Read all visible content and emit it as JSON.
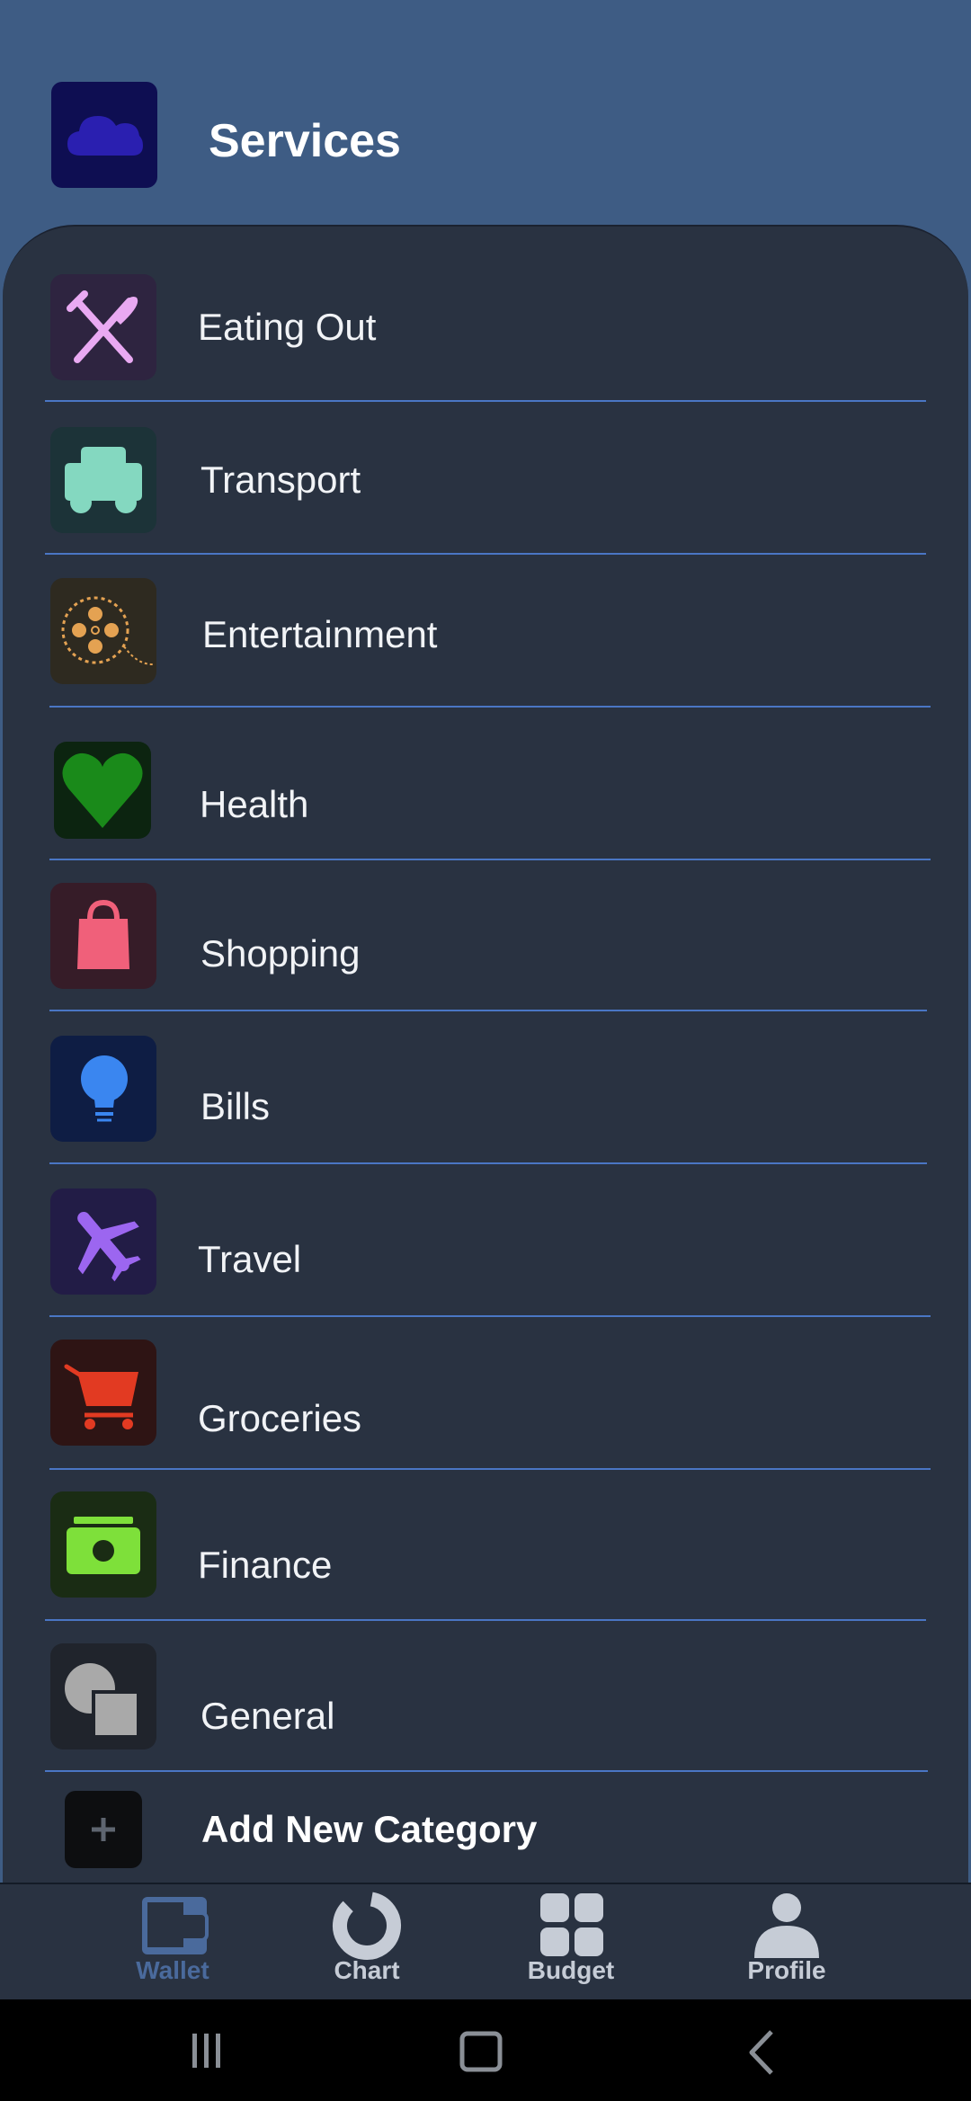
{
  "header": {
    "title": "Services",
    "icon": "cloud-icon"
  },
  "categories": [
    {
      "label": "Eating Out",
      "icon": "fork-knife-icon",
      "color": "#e9a9f2"
    },
    {
      "label": "Transport",
      "icon": "car-icon",
      "color": "#84d8c0"
    },
    {
      "label": "Entertainment",
      "icon": "film-reel-icon",
      "color": "#e4a252"
    },
    {
      "label": "Health",
      "icon": "heart-icon",
      "color": "#1a8a1a"
    },
    {
      "label": "Shopping",
      "icon": "shopping-bag-icon",
      "color": "#f0607a"
    },
    {
      "label": "Bills",
      "icon": "lightbulb-icon",
      "color": "#3a86f0"
    },
    {
      "label": "Travel",
      "icon": "airplane-icon",
      "color": "#9c66f0"
    },
    {
      "label": "Groceries",
      "icon": "cart-icon",
      "color": "#e23a22"
    },
    {
      "label": "Finance",
      "icon": "money-icon",
      "color": "#7ee03a"
    },
    {
      "label": "General",
      "icon": "shapes-icon",
      "color": "#a9a9a9"
    }
  ],
  "add_category": {
    "label": "Add New Category",
    "icon": "plus-icon"
  },
  "nav": [
    {
      "label": "Wallet",
      "icon": "wallet-icon",
      "active": true
    },
    {
      "label": "Chart",
      "icon": "donut-chart-icon",
      "active": false
    },
    {
      "label": "Budget",
      "icon": "grid-icon",
      "active": false
    },
    {
      "label": "Profile",
      "icon": "person-icon",
      "active": false
    }
  ],
  "colors": {
    "header_bg": "#3e5c84",
    "panel_bg": "#293241",
    "divider": "#4a76c4",
    "nav_active": "#4a6a9c",
    "nav_inactive": "#c6ccd6"
  }
}
